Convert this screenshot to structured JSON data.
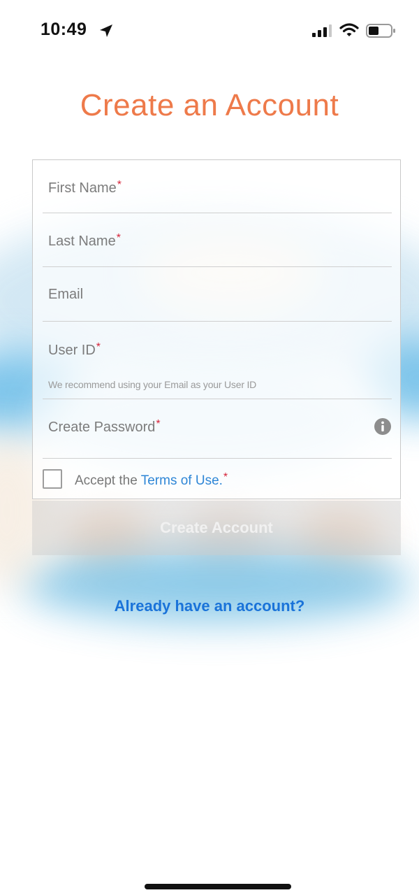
{
  "status_bar": {
    "time": "10:49",
    "location_icon": "location-arrow-icon",
    "signal_icon": "cellular-signal-icon",
    "wifi_icon": "wifi-icon",
    "battery_icon": "battery-icon"
  },
  "page": {
    "title": "Create an Account"
  },
  "form": {
    "first_name_label": "First Name",
    "last_name_label": "Last Name",
    "email_label": "Email",
    "user_id_label": "User ID",
    "user_id_hint": "We recommend using your Email as your User ID",
    "password_label": "Create Password",
    "required_mark": "*",
    "info_icon": "info-icon",
    "terms_prefix": "Accept the ",
    "terms_link": "Terms of Use.",
    "terms_checked": false
  },
  "actions": {
    "create_account": "Create Account",
    "already_have_account": "Already have an account?"
  },
  "colors": {
    "title": "#ee7a4a",
    "link": "#1a73d9",
    "required": "#d6243a"
  }
}
